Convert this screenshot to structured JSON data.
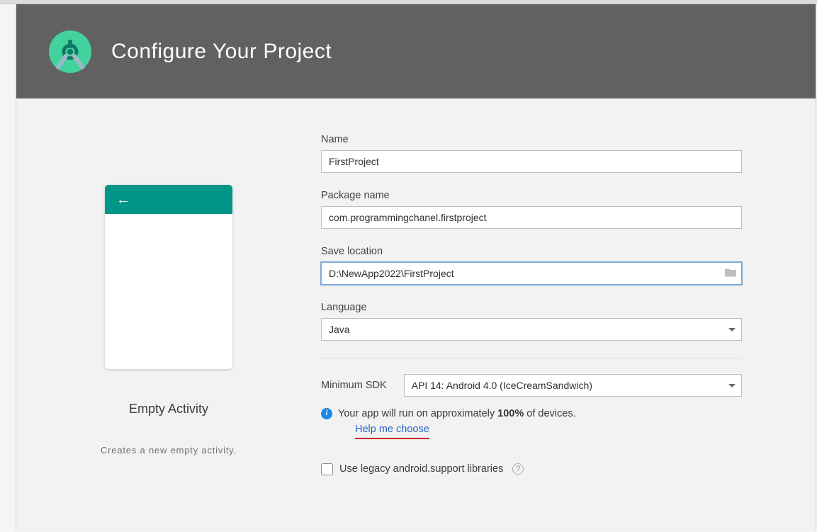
{
  "header": {
    "title": "Configure Your Project"
  },
  "preview": {
    "template_name": "Empty Activity",
    "template_desc": "Creates a new empty activity."
  },
  "form": {
    "name": {
      "label": "Name",
      "value": "FirstProject"
    },
    "package": {
      "label": "Package name",
      "value": "com.programmingchanel.firstproject"
    },
    "location": {
      "label": "Save location",
      "value": "D:\\NewApp2022\\FirstProject"
    },
    "language": {
      "label": "Language",
      "value": "Java"
    },
    "sdk": {
      "label": "Minimum SDK",
      "value": "API 14: Android 4.0 (IceCreamSandwich)"
    },
    "info_prefix": "Your app will run on approximately ",
    "info_bold": "100%",
    "info_suffix": " of devices.",
    "help_link": "Help me choose",
    "legacy": {
      "label": "Use legacy android.support libraries"
    }
  }
}
